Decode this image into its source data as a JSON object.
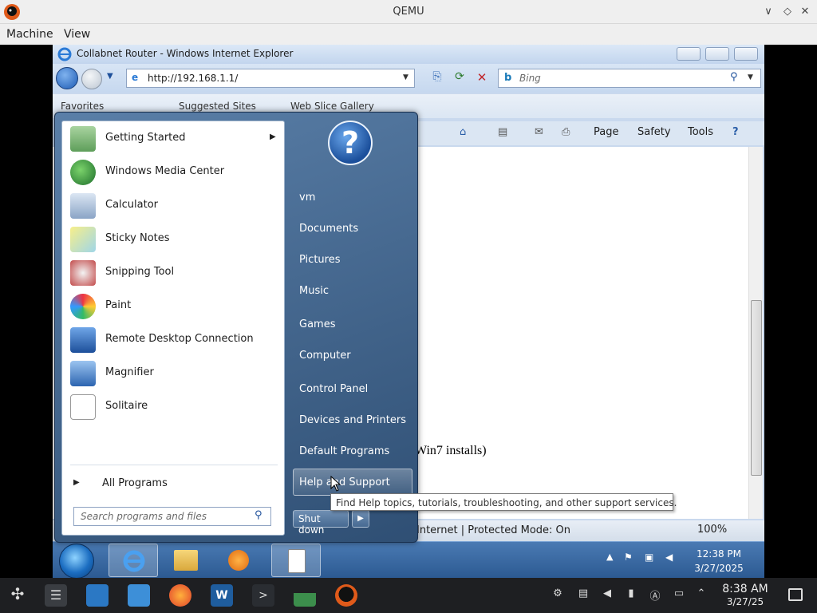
{
  "qemu": {
    "window_title": "QEMU",
    "menu": [
      "Machine",
      "View"
    ],
    "controls": {
      "minimize": "∨",
      "maximize": "◇",
      "close": "✕"
    }
  },
  "ie": {
    "window_title": "Collabnet Router - Windows Internet Explorer",
    "address": "http://192.168.1.1/",
    "search_placeholder": "Bing",
    "favorites_bar": [
      "Favorites",
      "Suggested Sites",
      "Web Slice Gallery"
    ],
    "command_bar": [
      "Page",
      "Safety",
      "Tools"
    ],
    "content_text": "Win7 installs)",
    "status_zone": "Internet | Protected Mode: On",
    "zoom": "100%"
  },
  "start_menu": {
    "programs": [
      {
        "label": "Getting Started",
        "icon": "getting-started-icon",
        "has_arrow": true
      },
      {
        "label": "Windows Media Center",
        "icon": "media-center-icon"
      },
      {
        "label": "Calculator",
        "icon": "calculator-icon"
      },
      {
        "label": "Sticky Notes",
        "icon": "sticky-notes-icon"
      },
      {
        "label": "Snipping Tool",
        "icon": "snipping-tool-icon"
      },
      {
        "label": "Paint",
        "icon": "paint-icon"
      },
      {
        "label": "Remote Desktop Connection",
        "icon": "remote-desktop-icon"
      },
      {
        "label": "Magnifier",
        "icon": "magnifier-icon"
      },
      {
        "label": "Solitaire",
        "icon": "solitaire-icon"
      }
    ],
    "all_programs": "All Programs",
    "search_placeholder": "Search programs and files",
    "right_items": [
      "vm",
      "Documents",
      "Pictures",
      "Music",
      "Games",
      "Computer",
      "Control Panel",
      "Devices and Printers",
      "Default Programs",
      "Help and Support"
    ],
    "highlighted": "Help and Support",
    "shutdown": "Shut down",
    "tooltip": "Find Help topics, tutorials, troubleshooting, and other support services."
  },
  "guest_taskbar": {
    "time": "12:38 PM",
    "date": "3/27/2025"
  },
  "host_taskbar": {
    "time": "8:38 AM",
    "date": "3/27/25"
  }
}
